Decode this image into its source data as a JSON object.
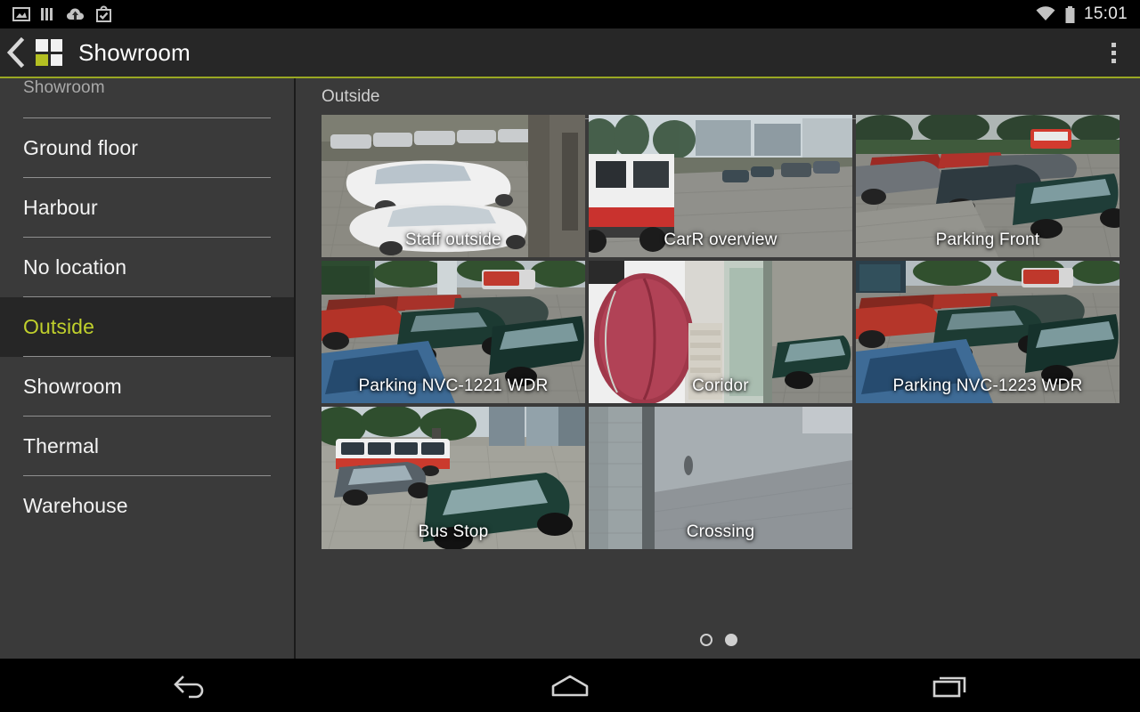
{
  "status_bar": {
    "icons": [
      "screenshot-icon",
      "bars-icon",
      "cloud-upload-icon",
      "bag-check-icon"
    ],
    "wifi_icon": "wifi-icon",
    "battery_icon": "battery-full-icon",
    "clock": "15:01"
  },
  "app_bar": {
    "back_icon": "back-chevron-icon",
    "logo_icon": "app-logo-icon",
    "title": "Showroom",
    "overflow_icon": "overflow-menu-icon",
    "accent_color": "#9aa823"
  },
  "sidebar": {
    "header": "Showroom",
    "items": [
      {
        "label": "Ground floor",
        "selected": false
      },
      {
        "label": "Harbour",
        "selected": false
      },
      {
        "label": "No location",
        "selected": false
      },
      {
        "label": "Outside",
        "selected": true
      },
      {
        "label": "Showroom",
        "selected": false
      },
      {
        "label": "Thermal",
        "selected": false
      },
      {
        "label": "Warehouse",
        "selected": false
      }
    ],
    "selected_color": "#c0d02c"
  },
  "content": {
    "title": "Outside",
    "cameras": [
      {
        "label": "Staff outside"
      },
      {
        "label": "CarR overview"
      },
      {
        "label": "Parking Front"
      },
      {
        "label": "Parking NVC-1221 WDR"
      },
      {
        "label": "Coridor"
      },
      {
        "label": "Parking NVC-1223 WDR"
      },
      {
        "label": "Bus Stop"
      },
      {
        "label": "Crossing"
      }
    ],
    "pager": {
      "pages": 2,
      "current_index": 1
    }
  },
  "nav_bar": {
    "back_icon": "nav-back-icon",
    "home_icon": "nav-home-icon",
    "recents_icon": "nav-recents-icon"
  }
}
